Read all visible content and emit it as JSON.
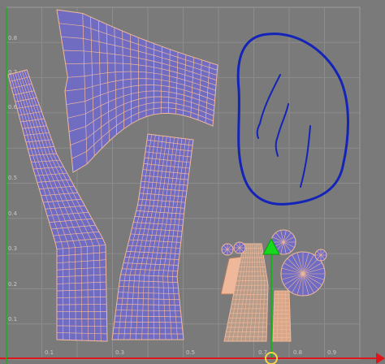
{
  "viewport": {
    "background": "#7a7a7a",
    "gridline_color": "#8c8c8c",
    "mesh_fill": "#6f6cc2",
    "mesh_edge": "#f0b89a",
    "axis_x_color": "#e0141b",
    "axis_y_color": "#18b01c",
    "annotation_color": "#1424b8"
  },
  "axes": {
    "y_ticks": [
      "0.8",
      "0.7",
      "0.6",
      "0.5",
      "0.4",
      "0.3",
      "0.2",
      "0.1"
    ],
    "x_ticks": [
      "0.1",
      "0.3",
      "0.5",
      "0.7",
      "0.8",
      "0.9"
    ]
  },
  "icons": {
    "gizmo": "transform-arrow-icon",
    "origin": "origin-circle-icon",
    "x_axis_end": "red-arrow-icon"
  }
}
